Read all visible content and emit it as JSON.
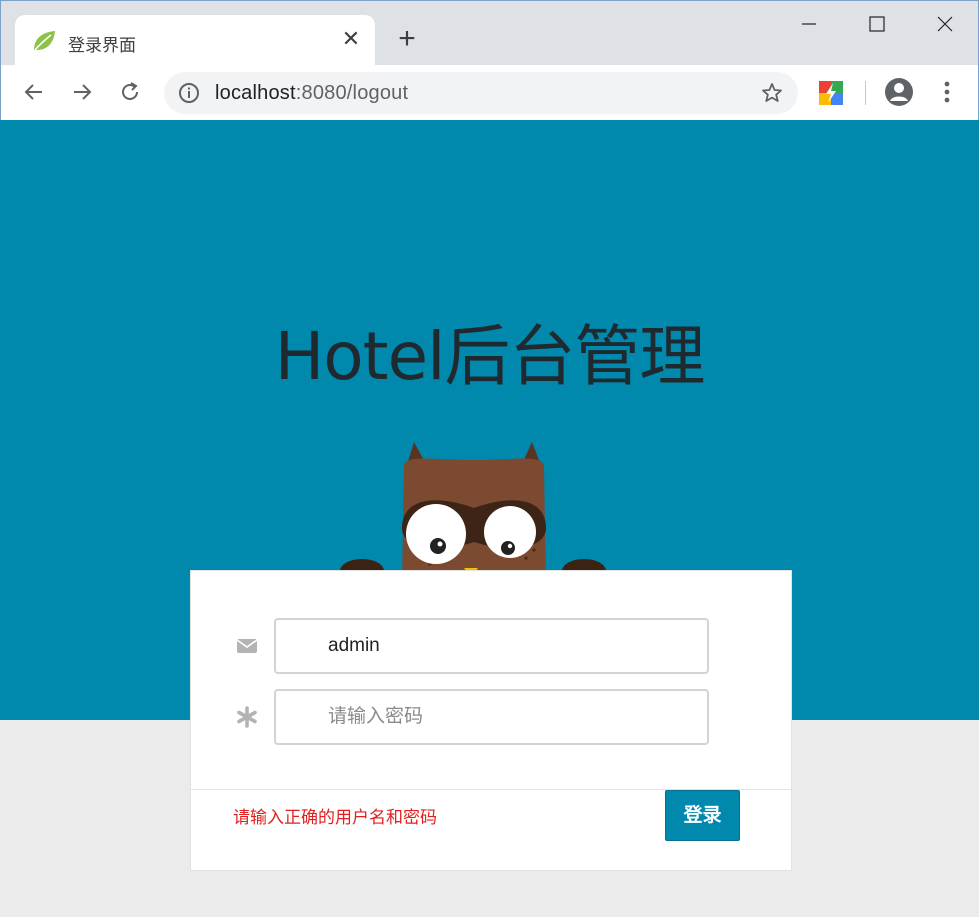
{
  "browser": {
    "tab_title": "登录界面",
    "tab_close": "✕",
    "new_tab": "+",
    "url_host": "localhost",
    "url_rest": ":8080/logout"
  },
  "page": {
    "heading": "Hotel后台管理",
    "username_value": "admin",
    "password_placeholder": "请输入密码",
    "error_message": "请输入正确的用户名和密码",
    "login_label": "登录"
  },
  "colors": {
    "hero_bg": "#0089ad",
    "error_text": "#e02020",
    "button_bg": "#0089ad"
  }
}
